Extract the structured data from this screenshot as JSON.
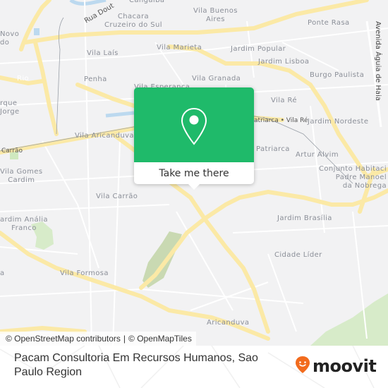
{
  "map": {
    "labels": [
      {
        "id": "cangaiba",
        "text": "Cangaíba"
      },
      {
        "id": "rua-doutor",
        "text": "Rua Dout"
      },
      {
        "id": "chacara",
        "text": "Chacara\nCruzeiro do Sul"
      },
      {
        "id": "vila-buenos-aires",
        "text": "Vila Buenos\nAires"
      },
      {
        "id": "ponte-rasa",
        "text": "Ponte Rasa"
      },
      {
        "id": "avenida-aguia",
        "text": "Avenida Águia de Haia"
      },
      {
        "id": "novo",
        "text": "Novo\ndo"
      },
      {
        "id": "vila-lais",
        "text": "Vila Laís"
      },
      {
        "id": "vila-marieta",
        "text": "Vila Marieta"
      },
      {
        "id": "jardim-popular",
        "text": "Jardim Popular"
      },
      {
        "id": "jardim-lisboa",
        "text": "Jardim Lisboa"
      },
      {
        "id": "burgo-paulista",
        "text": "Burgo Paulista"
      },
      {
        "id": "rio",
        "text": "Rio"
      },
      {
        "id": "penha",
        "text": "Penha"
      },
      {
        "id": "vila-granada",
        "text": "Vila Granada"
      },
      {
        "id": "vila-esperanca",
        "text": "Vila Esperança"
      },
      {
        "id": "vila-re",
        "text": "Vila Ré"
      },
      {
        "id": "parque-sao-jorge",
        "text": "rque\nJorge"
      },
      {
        "id": "patriarca-station",
        "text": "Patriarca • Vila Ré"
      },
      {
        "id": "jardim-nordeste",
        "text": "Jardim Nordeste"
      },
      {
        "id": "vila-aricanduva",
        "text": "Vila Aricanduva"
      },
      {
        "id": "patriarca",
        "text": "Patriarca"
      },
      {
        "id": "artur-alvim",
        "text": "Artur Alvim"
      },
      {
        "id": "carrao",
        "text": "Carrão"
      },
      {
        "id": "conjunto",
        "text": "Conjunto Habitaci\nPadre Manoel\nda Nobrega"
      },
      {
        "id": "vila-gomes-cardim",
        "text": "Vila Gomes\nCardim"
      },
      {
        "id": "vila-carrao",
        "text": "Vila Carrão"
      },
      {
        "id": "jardim-brasilia",
        "text": "Jardim Brasília"
      },
      {
        "id": "jardim-analia-franco",
        "text": "ardim Anália\nFranco"
      },
      {
        "id": "cidade-lider",
        "text": "Cidade Líder"
      },
      {
        "id": "vila-formosa",
        "text": "Vila Formosa"
      },
      {
        "id": "aricanduva",
        "text": "Aricanduva"
      },
      {
        "id": "left-a",
        "text": "a"
      }
    ],
    "colors": {
      "background": "#f2f2f3",
      "road_major": "#fbe9a6",
      "park": "#d7ebc9",
      "water": "#bcd9ef"
    }
  },
  "popup": {
    "icon": "location-pin-icon",
    "button_label": "Take me there",
    "accent": "#1fba6a"
  },
  "attribution": {
    "osm": "© OpenStreetMap contributors",
    "separator": "|",
    "omt": "© OpenMapTiles"
  },
  "footer": {
    "place_name": "Pacam Consultoria Em Recursos Humanos, Sao Paulo Region",
    "logo_text": "moovit",
    "logo_icon": "moovit-smile-pin-icon",
    "logo_accent": "#f26b1d"
  }
}
